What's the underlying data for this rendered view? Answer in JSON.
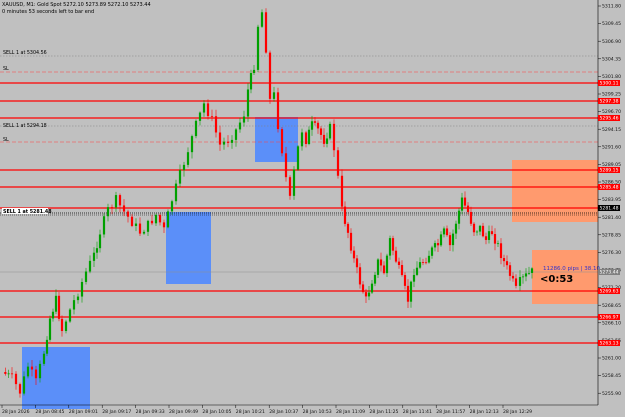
{
  "header": {
    "symbol_line": "XAUUSD, M1:  Gold Spot  5272.10 5273.89 5272.10 5273.44",
    "countdown_line": "0 minutes 53 seconds left to bar end"
  },
  "orders": [
    {
      "label": "SELL 1 at 5304.56",
      "sl": "SL"
    },
    {
      "label": "SELL 1 at 5294.18",
      "sl": "SL"
    },
    {
      "label": "SELL 1 at 5281.48"
    }
  ],
  "timer": "<0:53",
  "pips_label": "11286.0 pips | 38.10",
  "price_axis": {
    "ticks": [
      "5311.80",
      "5309.45",
      "5306.90",
      "5304.35",
      "5301.80",
      "5299.25",
      "5296.70",
      "5294.15",
      "5291.60",
      "5289.05",
      "5286.50",
      "5283.95",
      "5281.40",
      "5278.85",
      "5276.30",
      "5273.75",
      "5271.20",
      "5268.65",
      "5266.10",
      "5263.55",
      "5261.00",
      "5258.45",
      "5255.90"
    ],
    "level_labels": [
      {
        "text": "5300.11",
        "color": "#ff0000"
      },
      {
        "text": "5297.38",
        "color": "#ff0000"
      },
      {
        "text": "5295.46",
        "color": "#ff0000"
      },
      {
        "text": "5289.15",
        "color": "#ff0000"
      },
      {
        "text": "5285.48",
        "color": "#ff0000"
      },
      {
        "text": "5281.48",
        "color": "#000000"
      },
      {
        "text": "5273.44",
        "color": "#808080"
      },
      {
        "text": "5269.63",
        "color": "#ff0000"
      },
      {
        "text": "5266.97",
        "color": "#ff0000"
      },
      {
        "text": "5263.13",
        "color": "#ff0000"
      }
    ]
  },
  "time_axis": {
    "ticks": [
      "28 Jan 2026",
      "28 Jan 08:45",
      "28 Jan 09:01",
      "28 Jan 09:17",
      "28 Jan 09:33",
      "28 Jan 09:49",
      "28 Jan 10:05",
      "28 Jan 10:21",
      "28 Jan 10:37",
      "28 Jan 10:53",
      "28 Jan 11:09",
      "28 Jan 11:25",
      "28 Jan 11:41",
      "28 Jan 11:57",
      "28 Jan 12:13",
      "28 Jan 12:29"
    ]
  },
  "colors": {
    "background": "#c0c0c0",
    "bull_candle": "#00a000",
    "bear_candle": "#ff0000",
    "level_line": "#ff0000",
    "demand_zone": "#5b8ff9",
    "supply_zone": "#ff9a6e",
    "axis_bg": "#c0c0c0"
  }
}
